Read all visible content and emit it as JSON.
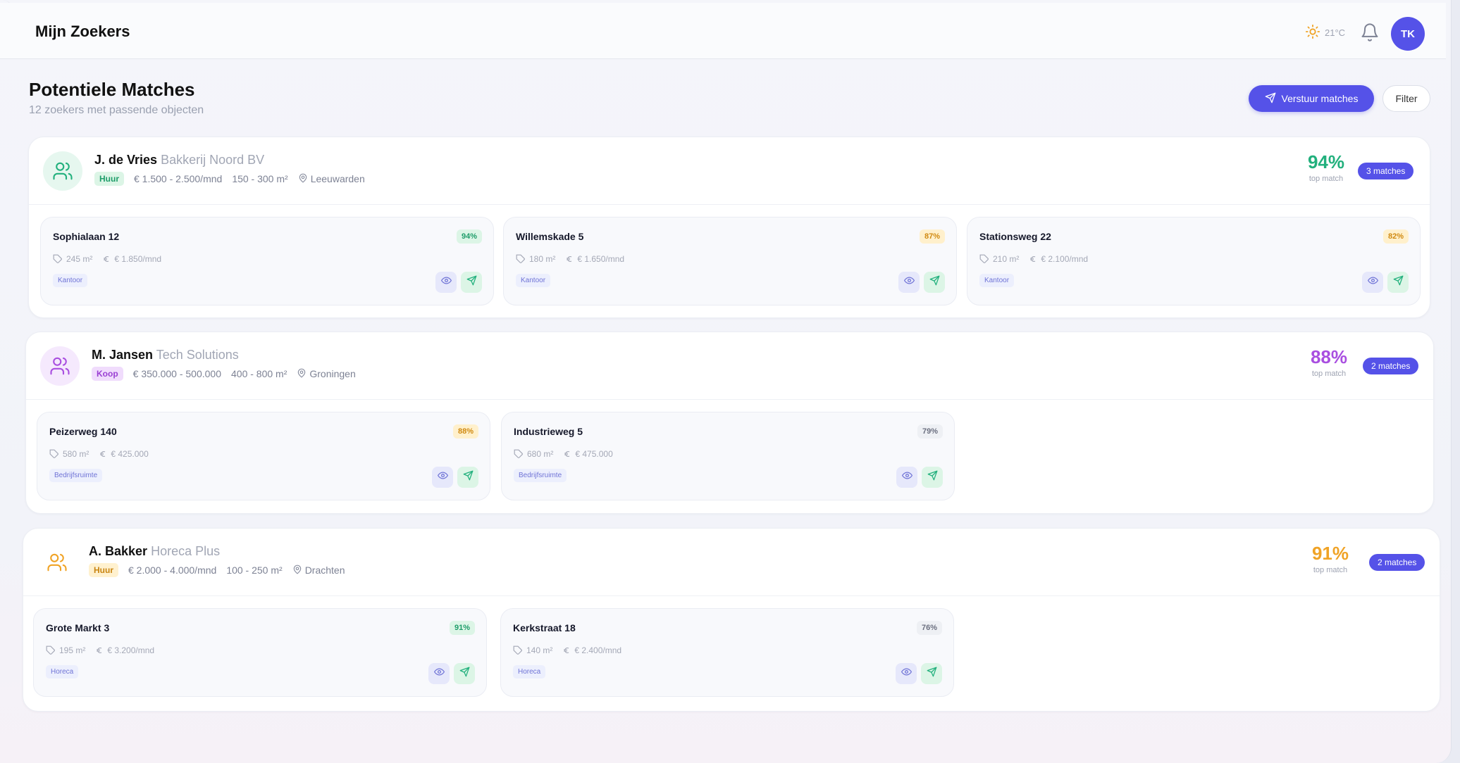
{
  "header": {
    "app_title": "Mijn Zoekers",
    "weather_temp": "21°C",
    "weather_icon": "sun-icon",
    "avatar_initials": "TK"
  },
  "page": {
    "title": "Potentiele Matches",
    "subtitle": "12 zoekers met passende objecten",
    "send_button": "Verstuur matches",
    "filter_button": "Filter"
  },
  "colors": {
    "accent": "#5552e8",
    "green": "#22b07d",
    "purple": "#a94fe0",
    "orange": "#f0a326"
  },
  "groups": [
    {
      "name": "J. de Vries",
      "company": "Bakkerij Noord BV",
      "type": "Huur",
      "budget": "€ 1.500 - 2.500/mnd",
      "size": "150 - 300 m²",
      "location": "Leeuwarden",
      "top_score": "94%",
      "top_label": "top match",
      "matches_badge": "3 matches",
      "cards": [
        {
          "title": "Sophialaan 12",
          "score": "94%",
          "size": "245 m²",
          "price": "€ 1.850/mnd",
          "tag": "Kantoor"
        },
        {
          "title": "Willemskade 5",
          "score": "87%",
          "size": "180 m²",
          "price": "€ 1.650/mnd",
          "tag": "Kantoor"
        },
        {
          "title": "Stationsweg 22",
          "score": "82%",
          "size": "210 m²",
          "price": "€ 2.100/mnd",
          "tag": "Kantoor"
        }
      ]
    },
    {
      "name": "M. Jansen",
      "company": "Tech Solutions",
      "type": "Koop",
      "budget": "€ 350.000 - 500.000",
      "size": "400 - 800 m²",
      "location": "Groningen",
      "top_score": "88%",
      "top_label": "top match",
      "matches_badge": "2 matches",
      "cards": [
        {
          "title": "Peizerweg 140",
          "score": "88%",
          "size": "580 m²",
          "price": "€ 425.000",
          "tag": "Bedrijfsruimte"
        },
        {
          "title": "Industrieweg 5",
          "score": "79%",
          "size": "680 m²",
          "price": "€ 475.000",
          "tag": "Bedrijfsruimte"
        }
      ]
    },
    {
      "name": "A. Bakker",
      "company": "Horeca Plus",
      "type": "Huur",
      "budget": "€ 2.000 - 4.000/mnd",
      "size": "100 - 250 m²",
      "location": "Drachten",
      "top_score": "91%",
      "top_label": "top match",
      "matches_badge": "2 matches",
      "cards": [
        {
          "title": "Grote Markt 3",
          "score": "91%",
          "size": "195 m²",
          "price": "€ 3.200/mnd",
          "tag": "Horeca"
        },
        {
          "title": "Kerkstraat 18",
          "score": "76%",
          "size": "140 m²",
          "price": "€ 2.400/mnd",
          "tag": "Horeca"
        }
      ]
    }
  ]
}
